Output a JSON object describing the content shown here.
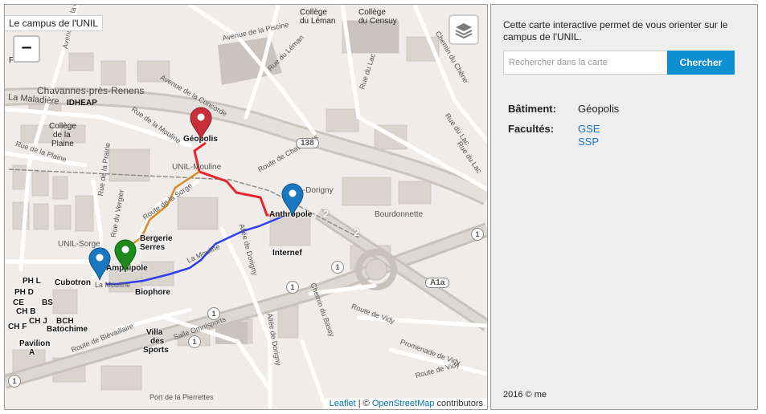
{
  "map": {
    "title": "Le campus de l'UNIL",
    "zoom_out_label": "−",
    "layers_icon": "layers-icon",
    "attribution": {
      "leaflet": "Leaflet",
      "sep": " | © ",
      "osm": "OpenStreetMap",
      "rest": " contributors"
    },
    "route_colors": {
      "red": "#e8262f",
      "orange": "#d98a26",
      "blue": "#2f3ee8"
    },
    "markers": [
      {
        "name": "Géopolis",
        "color": "#c92f38"
      },
      {
        "name": "Anthropole",
        "color": "#1a78c2"
      },
      {
        "name": "Amphipole",
        "color": "#1e8a1e"
      },
      {
        "name": "Cubotron",
        "color": "#1a78c2"
      }
    ],
    "labels": {
      "chavannes": "Chavannes-près-Renens",
      "maladiere": "La Maladière",
      "idheap": "IDHEAP",
      "college_plaine_1": "Collège",
      "college_plaine_2": "de la",
      "college_plaine_3": "Plaine",
      "fleun": "Fleun",
      "college_leman_1": "Collège",
      "college_leman_2": "du Léman",
      "college_censuy_1": "Collège",
      "college_censuy_2": "du Censuy",
      "geopolis": "Géopolis",
      "anthropole": "Anthropole",
      "amphipole": "Amphipole",
      "internef": "Internef",
      "bergerie": "Bergerie",
      "serres": "Serres",
      "cubotron": "Cubotron",
      "biophore": "Biophore",
      "batochime": "Batochime",
      "villa_sports_1": "Villa",
      "villa_sports_2": "des",
      "villa_sports_3": "Sports",
      "pavilion_a_1": "Pavilion",
      "pavilion_a_2": "A",
      "ph_l": "PH L",
      "ph_d": "PH D",
      "ce": "CE",
      "bs": "BS",
      "ch_b": "CH B",
      "ch_j": "CH J",
      "ch_f": "CH F",
      "bch": "BCH",
      "unil_sorge": "UNIL-Sorge",
      "unil_mouline": "UNIL-Mouline",
      "unil_dorigny": "UNIL-Dorigny",
      "bourdonnette": "Bourdonnette",
      "salle_omnisports": "Salle Omnisports",
      "port_pierrettes": "Port de la Pierrettes",
      "road_138": "138",
      "road_a1a": "A1a",
      "route_2a": "2",
      "route_2b": "2",
      "route_1a": "1",
      "route_1b": "1",
      "route_1c": "1",
      "route_1d": "1",
      "route_1e": "1",
      "route_1f": "1",
      "st_avenue_gare": "Avenue de la Gare",
      "st_avenue_piscine": "Avenue de la Piscine",
      "st_rue_leman": "Rue du Léman",
      "st_rue_lac_1": "Rue du Lac",
      "st_rue_lac_2": "Rue du Lac",
      "st_rue_lac_3": "Rue du Lac",
      "st_chemin_chene": "Chemin du Chêne",
      "st_concorde": "Avenue de la Concorde",
      "st_mouline": "Rue de la Mouline",
      "st_plaine": "Rue de la Plaine",
      "st_prairie": "Rue de la Prairie",
      "st_vergier": "Rue du Vergier",
      "st_route_sorge": "Route de la Sorge",
      "st_dorigny": "Allée de Dorigny",
      "st_dorigny2": "Allée de Dorigny",
      "st_la_mouline": "La Mouline",
      "st_la_mouline2": "La Mouline",
      "st_chavannes": "Route de Chavannes",
      "st_bievaillaire": "Route de Bièvaillaire",
      "st_vidy1": "Route de Vidy",
      "st_vidy2": "Route de Vidy",
      "st_bassy": "Chemin du Bassy",
      "st_promenade_vidy": "Promenade de Vidy"
    }
  },
  "side": {
    "description": "Cette carte interactive permet de vous orienter sur le campus de l'UNIL.",
    "search_placeholder": "Rechercher dans la carte",
    "search_value": "",
    "search_button": "Chercher",
    "batiment_label": "Bâtiment:",
    "batiment_value": "Géopolis",
    "facultes_label": "Facultés:",
    "facultes": [
      "GSE",
      "SSP"
    ],
    "footer": "2016 © me"
  },
  "colors": {
    "button": "#0e8fd1",
    "link": "#1a73c9"
  }
}
